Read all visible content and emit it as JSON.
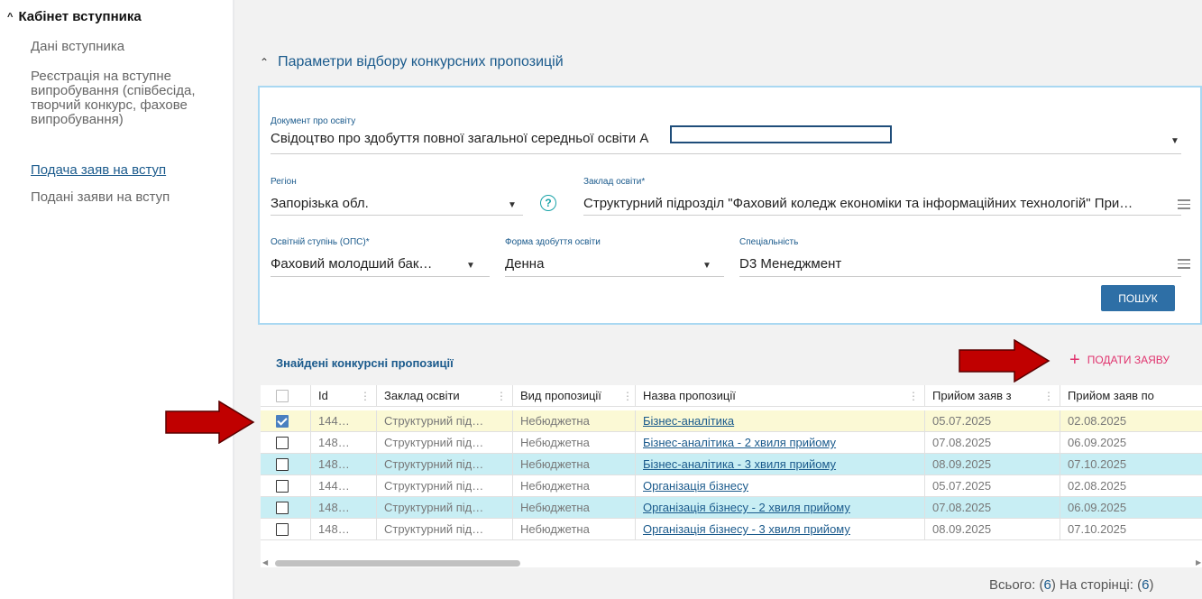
{
  "sidebar": {
    "title": "Кабінет вступника",
    "items": [
      {
        "label": "Дані вступника"
      },
      {
        "label": "Реєстрація на вступне випробування (співбесіда, творчий конкурс, фахове випробування)"
      },
      {
        "label": "Подача заяв на вступ"
      },
      {
        "label": "Подані заяви на вступ"
      }
    ]
  },
  "filters": {
    "header": "Параметри відбору конкурсних пропозицій",
    "document": {
      "label": "Документ про освіту",
      "value": "Свідоцтво про здобуття повної загальної середньої освіти А"
    },
    "region": {
      "label": "Регіон",
      "value": "Запорізька обл."
    },
    "institution": {
      "label": "Заклад освіти*",
      "value": "Структурний підрозділ \"Фаховий коледж економіки та інформаційних технологій\" При…"
    },
    "degree": {
      "label": "Освітній ступінь (ОПС)*",
      "value": "Фаховий молодший бак…"
    },
    "form": {
      "label": "Форма здобуття освіти",
      "value": "Денна"
    },
    "specialty": {
      "label": "Спеціальність",
      "value": "D3 Менеджмент"
    },
    "search_label": "ПОШУК"
  },
  "results": {
    "title": "Знайдені конкурсні пропозиції",
    "submit_label": "ПОДАТИ ЗАЯВУ",
    "columns": [
      "Id",
      "Заклад освіти",
      "Вид пропозиції",
      "Назва пропозиції",
      "Прийом заяв з",
      "Прийом заяв по"
    ],
    "rows": [
      {
        "id": "144…",
        "inst": "Структурний під…",
        "kind": "Небюджетна",
        "name": "Бізнес-аналітика",
        "from": "05.07.2025",
        "to": "02.08.2025",
        "checked": true
      },
      {
        "id": "148…",
        "inst": "Структурний під…",
        "kind": "Небюджетна",
        "name": "Бізнес-аналітика - 2 хвиля прийому",
        "from": "07.08.2025",
        "to": "06.09.2025",
        "checked": false
      },
      {
        "id": "148…",
        "inst": "Структурний під…",
        "kind": "Небюджетна",
        "name": "Бізнес-аналітика - 3 хвиля прийому",
        "from": "08.09.2025",
        "to": "07.10.2025",
        "checked": false
      },
      {
        "id": "144…",
        "inst": "Структурний під…",
        "kind": "Небюджетна",
        "name": "Організація бізнесу",
        "from": "05.07.2025",
        "to": "02.08.2025",
        "checked": false
      },
      {
        "id": "148…",
        "inst": "Структурний під…",
        "kind": "Небюджетна",
        "name": "Організація бізнесу - 2 хвиля прийому",
        "from": "07.08.2025",
        "to": "06.09.2025",
        "checked": false
      },
      {
        "id": "148…",
        "inst": "Структурний під…",
        "kind": "Небюджетна",
        "name": "Організація бізнесу - 3 хвиля прийому",
        "from": "08.09.2025",
        "to": "07.10.2025",
        "checked": false
      }
    ]
  },
  "footer": {
    "total_label": "Всього: (",
    "total": "6",
    "page_label": ") На сторінці: (",
    "page": "6",
    "close": ")"
  },
  "colors": {
    "accent": "#1a5a8c",
    "button": "#2e6fa6",
    "submit": "#e0336e",
    "arrow": "#c00000",
    "row_selected": "#fbf9d5",
    "row_alt": "#c8eef4"
  },
  "icons": [
    "chevron-up-icon",
    "dropdown-caret-icon",
    "help-icon",
    "list-icon",
    "plus-icon",
    "column-menu-icon",
    "arrow-annotation-icon"
  ]
}
